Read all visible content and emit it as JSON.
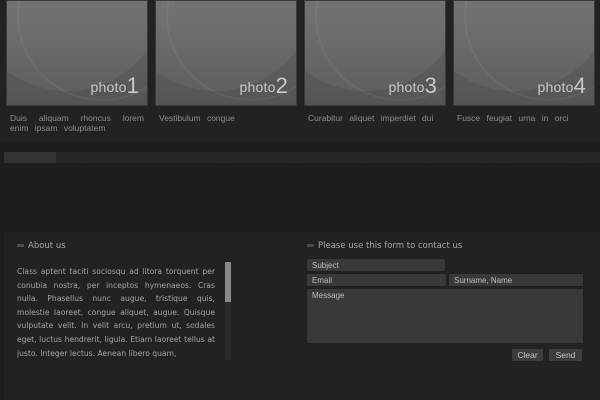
{
  "gallery": [
    {
      "label": "photo",
      "number": "1",
      "caption": "Duis aliquam rhoncus lorem enim ipsam voluptatem"
    },
    {
      "label": "photo",
      "number": "2",
      "caption": "Vestibulum congue"
    },
    {
      "label": "photo",
      "number": "3",
      "caption": "Curabitur aliquet imperdiet dui"
    },
    {
      "label": "photo",
      "number": "4",
      "caption": "Fusce feugiat urna in orci"
    }
  ],
  "about": {
    "title": "About us",
    "text": "Class aptent taciti sociosqu ad litora torquent per conubia nostra, per inceptos hymenaeos. Cras nulla. Phasellus nunc augue, tristique quis, molestie laoreet, congue aliquet, augue. Quisque vulputate velit. In velit arcu, pretium ut, sodales eget, luctus hendrerit, ligula. Etiam laoreet tellus at justo. Integer lectus. Aenean libero quam,"
  },
  "contact": {
    "title": "Please use this form to contact us",
    "subject_placeholder": "Subject",
    "email_placeholder": "Email",
    "name_placeholder": "Surname, Name",
    "message_placeholder": "Message",
    "clear_label": "Clear",
    "send_label": "Send"
  }
}
